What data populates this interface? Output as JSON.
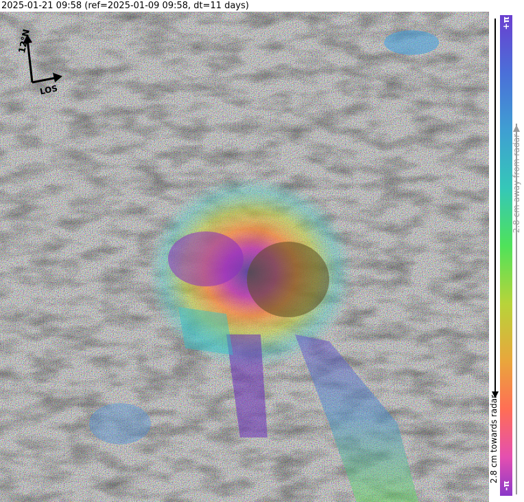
{
  "header": {
    "title": "2025-01-21 09:58 (ref=2025-01-09 09:58, dt=11 days)"
  },
  "colorbar": {
    "top_label": "+π",
    "bottom_label": "-π",
    "away_text": "2.8 cm away from radar",
    "towards_text": "2.8 cm towards radar"
  },
  "compass": {
    "north_label": "12°N",
    "los_label": "LOS"
  }
}
